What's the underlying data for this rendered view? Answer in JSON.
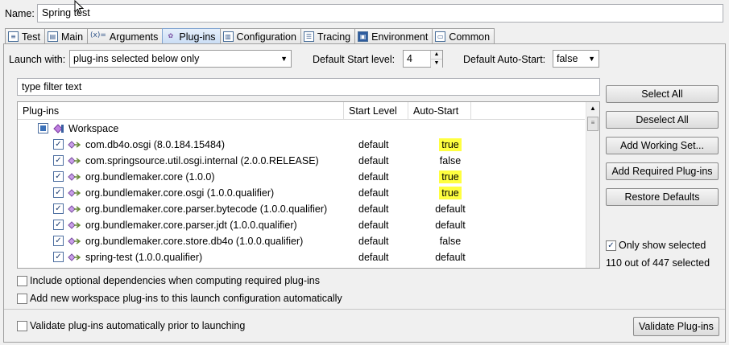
{
  "name_field": {
    "label": "Name:",
    "value": "Spring test"
  },
  "tabs": [
    {
      "label": "Test",
      "icon": "test-icon"
    },
    {
      "label": "Main",
      "icon": "main-icon"
    },
    {
      "label": "Arguments",
      "icon": "arguments-icon"
    },
    {
      "label": "Plug-ins",
      "icon": "plugins-icon",
      "active": true
    },
    {
      "label": "Configuration",
      "icon": "configuration-icon"
    },
    {
      "label": "Tracing",
      "icon": "tracing-icon"
    },
    {
      "label": "Environment",
      "icon": "environment-icon"
    },
    {
      "label": "Common",
      "icon": "common-icon"
    }
  ],
  "launch_with": {
    "label": "Launch with:",
    "value": "plug-ins selected below only"
  },
  "start_level": {
    "label": "Default Start level:",
    "value": "4"
  },
  "auto_start": {
    "label": "Default Auto-Start:",
    "value": "false"
  },
  "filter": {
    "placeholder": "type filter text"
  },
  "table": {
    "columns": [
      "Plug-ins",
      "Start Level",
      "Auto-Start"
    ],
    "group": "Workspace",
    "rows": [
      {
        "name": "com.db4o.osgi (8.0.184.15484)",
        "start": "default",
        "auto": "true"
      },
      {
        "name": "com.springsource.util.osgi.internal (2.0.0.RELEASE)",
        "start": "default",
        "auto": "false"
      },
      {
        "name": "org.bundlemaker.core (1.0.0)",
        "start": "default",
        "auto": "true"
      },
      {
        "name": "org.bundlemaker.core.osgi (1.0.0.qualifier)",
        "start": "default",
        "auto": "true"
      },
      {
        "name": "org.bundlemaker.core.parser.bytecode (1.0.0.qualifier)",
        "start": "default",
        "auto": "default"
      },
      {
        "name": "org.bundlemaker.core.parser.jdt (1.0.0.qualifier)",
        "start": "default",
        "auto": "default"
      },
      {
        "name": "org.bundlemaker.core.store.db4o (1.0.0.qualifier)",
        "start": "default",
        "auto": "false"
      },
      {
        "name": "spring-test (1.0.0.qualifier)",
        "start": "default",
        "auto": "default"
      }
    ]
  },
  "buttons": {
    "select_all": "Select All",
    "deselect_all": "Deselect All",
    "add_working_set": "Add Working Set...",
    "add_required": "Add Required Plug-ins",
    "restore_defaults": "Restore Defaults",
    "validate": "Validate Plug-ins"
  },
  "only_show_selected": "Only show selected",
  "selected_count": "110 out of 447 selected",
  "options": {
    "include_optional": "Include optional dependencies when computing required plug-ins",
    "add_new_workspace": "Add new workspace plug-ins to this launch configuration automatically",
    "validate_auto": "Validate plug-ins automatically prior to launching"
  },
  "colors": {
    "highlight": "#ffff40",
    "tab_active": "#c9ddf5"
  }
}
